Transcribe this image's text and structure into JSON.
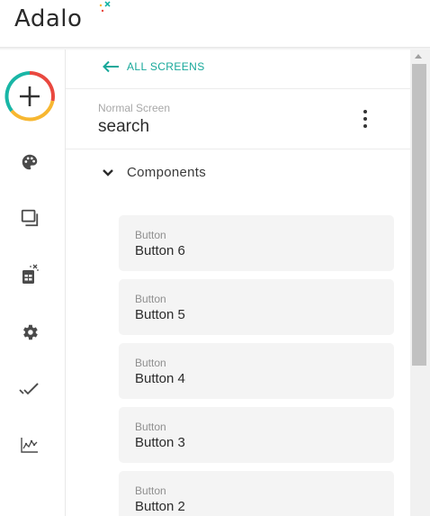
{
  "app": {
    "logo_text": "Adalo"
  },
  "sidebar": {
    "add_icon": "plus-icon",
    "items": [
      {
        "icon": "palette-icon",
        "name": "branding"
      },
      {
        "icon": "screens-icon",
        "name": "screens"
      },
      {
        "icon": "database-icon",
        "name": "database"
      },
      {
        "icon": "gear-icon",
        "name": "settings"
      },
      {
        "icon": "double-check-icon",
        "name": "publish"
      },
      {
        "icon": "analytics-icon",
        "name": "analytics"
      }
    ],
    "colors": {
      "ring_red": "#e9483f",
      "ring_yellow": "#f7b731",
      "ring_teal": "#19b6a6"
    }
  },
  "panel": {
    "back_label": "ALL SCREENS",
    "screen_type": "Normal Screen",
    "screen_name": "search",
    "components_label": "Components",
    "components": [
      {
        "type": "Button",
        "name": "Button 6"
      },
      {
        "type": "Button",
        "name": "Button 5"
      },
      {
        "type": "Button",
        "name": "Button 4"
      },
      {
        "type": "Button",
        "name": "Button 3"
      },
      {
        "type": "Button",
        "name": "Button 2"
      }
    ],
    "accent": "#17a89a"
  }
}
